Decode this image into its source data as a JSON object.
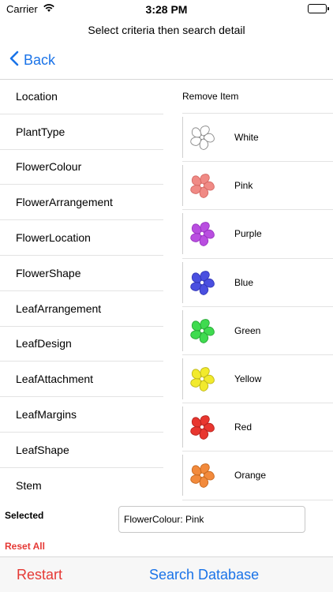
{
  "status_bar": {
    "carrier": "Carrier",
    "time": "3:28 PM"
  },
  "header": {
    "prompt": "Select criteria then search detail",
    "back_label": "Back"
  },
  "criteria": [
    {
      "label": "Location"
    },
    {
      "label": "PlantType"
    },
    {
      "label": "FlowerColour"
    },
    {
      "label": "FlowerArrangement"
    },
    {
      "label": "FlowerLocation"
    },
    {
      "label": "FlowerShape"
    },
    {
      "label": "LeafArrangement"
    },
    {
      "label": "LeafDesign"
    },
    {
      "label": "LeafAttachment"
    },
    {
      "label": "LeafMargins"
    },
    {
      "label": "LeafShape"
    },
    {
      "label": "Stem"
    }
  ],
  "values_panel": {
    "remove_label": "Remove Item",
    "colours": [
      {
        "label": "White",
        "color": "#ffffff",
        "stroke": "#8a8a8a",
        "icon": "flower-white-icon"
      },
      {
        "label": "Pink",
        "color": "#f08a85",
        "stroke": "#d56a65",
        "icon": "flower-pink-icon"
      },
      {
        "label": "Purple",
        "color": "#b94ee0",
        "stroke": "#9a35c2",
        "icon": "flower-purple-icon"
      },
      {
        "label": "Blue",
        "color": "#4a4fe0",
        "stroke": "#3438b8",
        "icon": "flower-blue-icon"
      },
      {
        "label": "Green",
        "color": "#3fdb4f",
        "stroke": "#2aa838",
        "icon": "flower-green-icon"
      },
      {
        "label": "Yellow",
        "color": "#f2ea2c",
        "stroke": "#bfb81c",
        "icon": "flower-yellow-icon"
      },
      {
        "label": "Red",
        "color": "#e8362f",
        "stroke": "#b82520",
        "icon": "flower-red-icon"
      },
      {
        "label": "Orange",
        "color": "#f28a3c",
        "stroke": "#c86a22",
        "icon": "flower-orange-icon"
      }
    ]
  },
  "selection": {
    "label": "Selected",
    "value": "FlowerColour: Pink",
    "reset_label": "Reset All"
  },
  "bottom_bar": {
    "restart_label": "Restart",
    "search_label": "Search Database"
  },
  "colors": {
    "accent": "#1a73e8",
    "destructive": "#e53935"
  }
}
